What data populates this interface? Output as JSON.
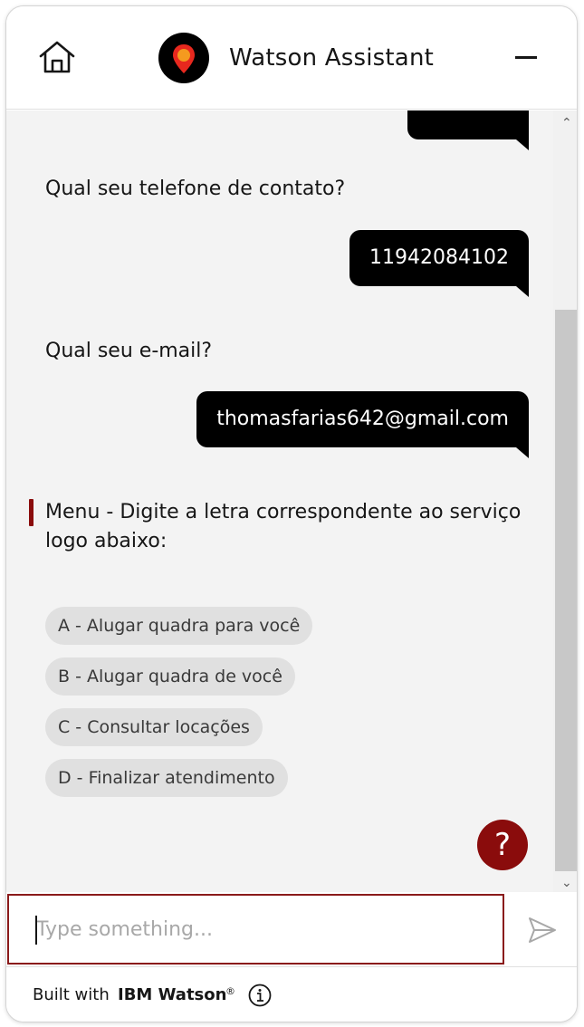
{
  "header": {
    "title": "Watson Assistant",
    "home_icon": "home-icon",
    "minimize_icon": "minimize-icon",
    "avatar_icon": "location-pin-icon"
  },
  "messages": {
    "user_1": "",
    "bot_1": "Qual seu telefone de contato?",
    "user_2": "11942084102",
    "bot_2": "Qual seu e-mail?",
    "user_3": "thomasfarias642@gmail.com",
    "bot_menu_line1": "Menu - Digite a letra correspondente ao serviço",
    "bot_menu_line2": "logo abaixo:"
  },
  "options": [
    {
      "label": "A - Alugar quadra para você"
    },
    {
      "label": "B - Alugar quadra de você"
    },
    {
      "label": "C - Consultar locações"
    },
    {
      "label": "D - Finalizar atendimento"
    }
  ],
  "help": {
    "label": "?"
  },
  "input": {
    "placeholder": "Type something...",
    "value": ""
  },
  "footer": {
    "built_with": "Built with",
    "brand": "IBM Watson",
    "reg": "®"
  },
  "colors": {
    "accent": "#8a0c0c",
    "bubble": "#000000",
    "chip": "#e0e0e0",
    "background": "#f3f3f3"
  }
}
